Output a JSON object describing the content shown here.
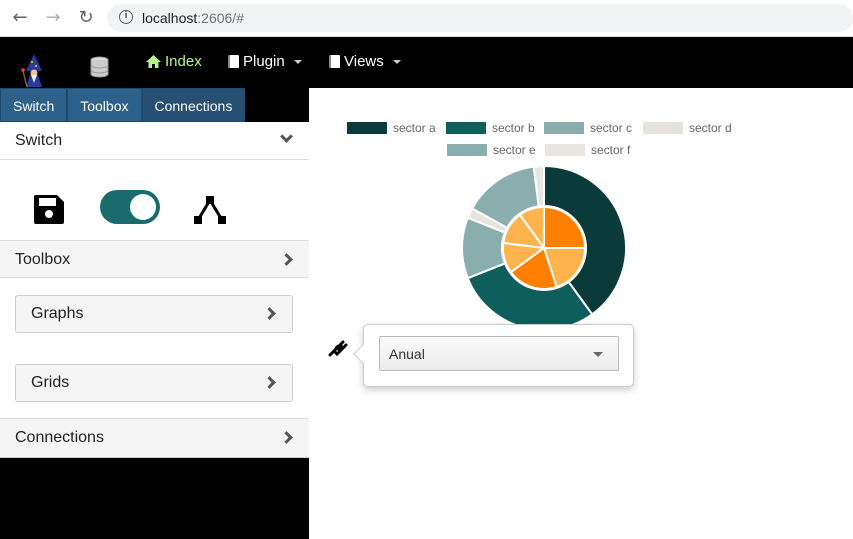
{
  "browser": {
    "url_host": "localhost",
    "url_rest": ":2606/#"
  },
  "navbar": {
    "index_label": "Index",
    "plugin_label": "Plugin",
    "views_label": "Views"
  },
  "tabs": [
    {
      "label": "Switch"
    },
    {
      "label": "Toolbox"
    },
    {
      "label": "Connections"
    }
  ],
  "panels": {
    "switch_title": "Switch",
    "toolbox_title": "Toolbox",
    "graphs_label": "Graphs",
    "grids_label": "Grids",
    "connections_title": "Connections"
  },
  "toggle": {
    "on": true
  },
  "select": {
    "value": "Anual"
  },
  "colors": {
    "accent": "#1a6b6b",
    "tab_blue": "#2d6189",
    "index_green": "#b6f58a"
  },
  "chart_data": {
    "type": "pie",
    "legend_position": "top",
    "outer": {
      "labels": [
        "sector a",
        "sector b",
        "sector c",
        "sector d",
        "sector e",
        "sector f"
      ],
      "values": [
        40,
        29,
        12,
        2,
        15,
        2
      ],
      "colors": [
        "#0a3a3a",
        "#0e5e5e",
        "#8aaeae",
        "#e6e3df",
        "#8aaeae",
        "#e9e6e2"
      ]
    },
    "inner": {
      "values": [
        25,
        20,
        20,
        12,
        13,
        10
      ],
      "colors": [
        "#ff8000",
        "#ffb34d",
        "#ff8000",
        "#ffb34d",
        "#ffb34d",
        "#ffb34d"
      ]
    }
  }
}
